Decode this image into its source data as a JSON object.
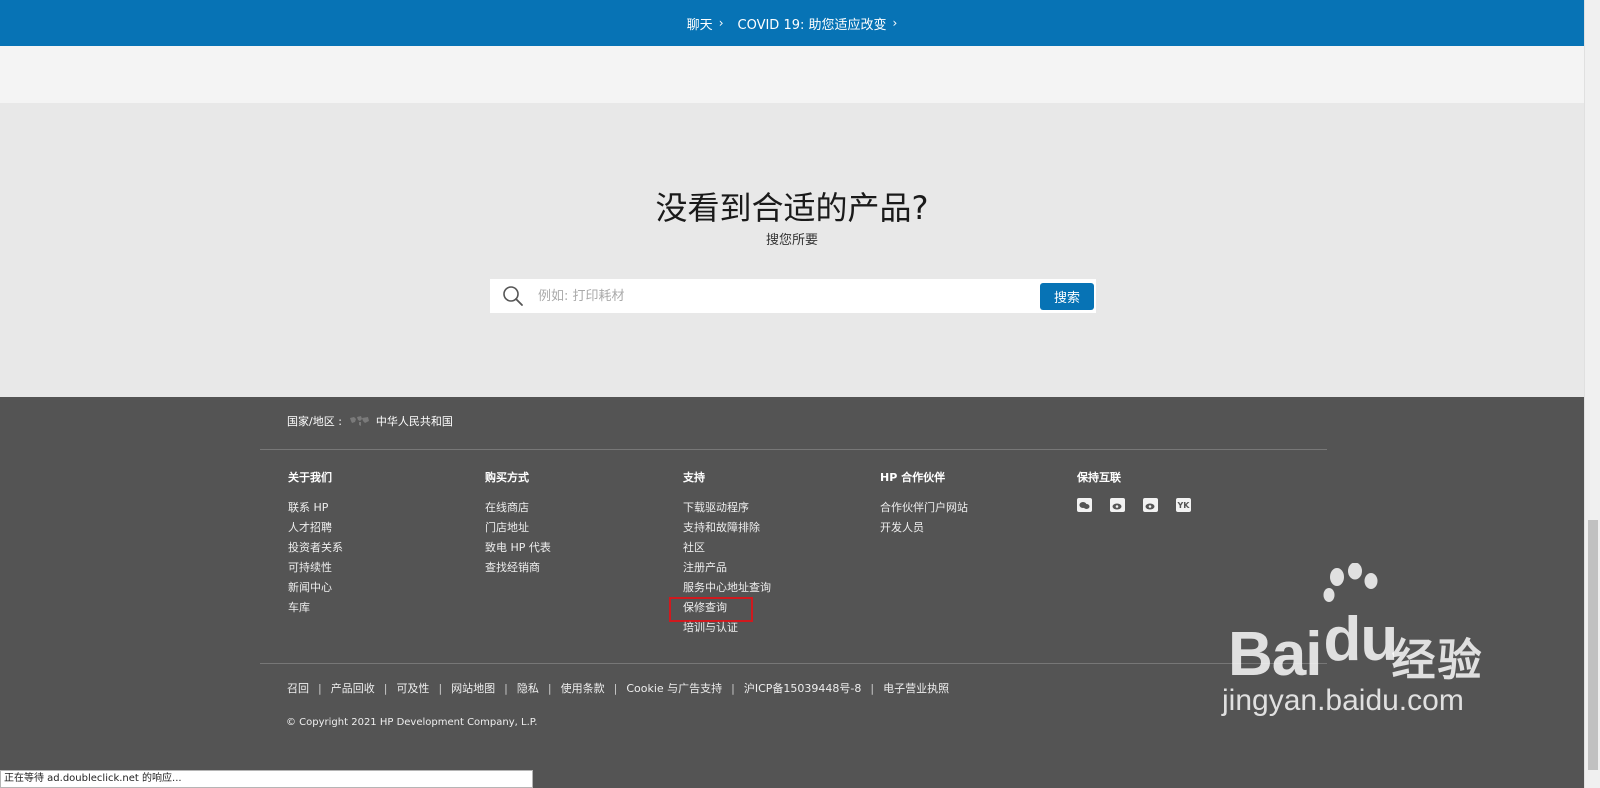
{
  "banner": {
    "chat": "聊天",
    "covid": "COVID 19: 助您适应改变"
  },
  "search": {
    "title": "没看到合适的产品?",
    "subtitle": "搜您所要",
    "placeholder": "例如: 打印耗材",
    "button": "搜索"
  },
  "footer": {
    "country_label": "国家/地区 :",
    "country_value": "中华人民共和国",
    "columns": [
      {
        "title": "关于我们",
        "items": [
          "联系 HP",
          "人才招聘",
          "投资者关系",
          "可持续性",
          "新闻中心",
          "车库"
        ]
      },
      {
        "title": "购买方式",
        "items": [
          "在线商店",
          "门店地址",
          "致电 HP 代表",
          "查找经销商"
        ]
      },
      {
        "title": "支持",
        "items": [
          "下载驱动程序",
          "支持和故障排除",
          "社区",
          "注册产品",
          "服务中心地址查询",
          "保修查询",
          "培训与认证"
        ]
      },
      {
        "title": "HP 合作伙伴",
        "items": [
          "合作伙伴门户网站",
          "开发人员"
        ]
      },
      {
        "title": "保持互联"
      }
    ],
    "social_icons": [
      "wechat-icon",
      "weibo-icon",
      "weibo-icon",
      "youku-icon"
    ],
    "social_youku_text": "YK",
    "bottom_links": [
      "召回",
      "产品回收",
      "可及性",
      "网站地图",
      "隐私",
      "使用条款",
      "Cookie 与广告支持",
      "沪ICP备15039448号-8",
      "电子营业执照"
    ],
    "copyright": "© Copyright 2021 HP Development Company, L.P."
  },
  "status_bar": "正在等待 ad.doubleclick.net 的响应...",
  "watermark": {
    "logo_main": "Bai",
    "logo_du": "du",
    "logo_cn": "经验",
    "url": "jingyan.baidu.com"
  }
}
